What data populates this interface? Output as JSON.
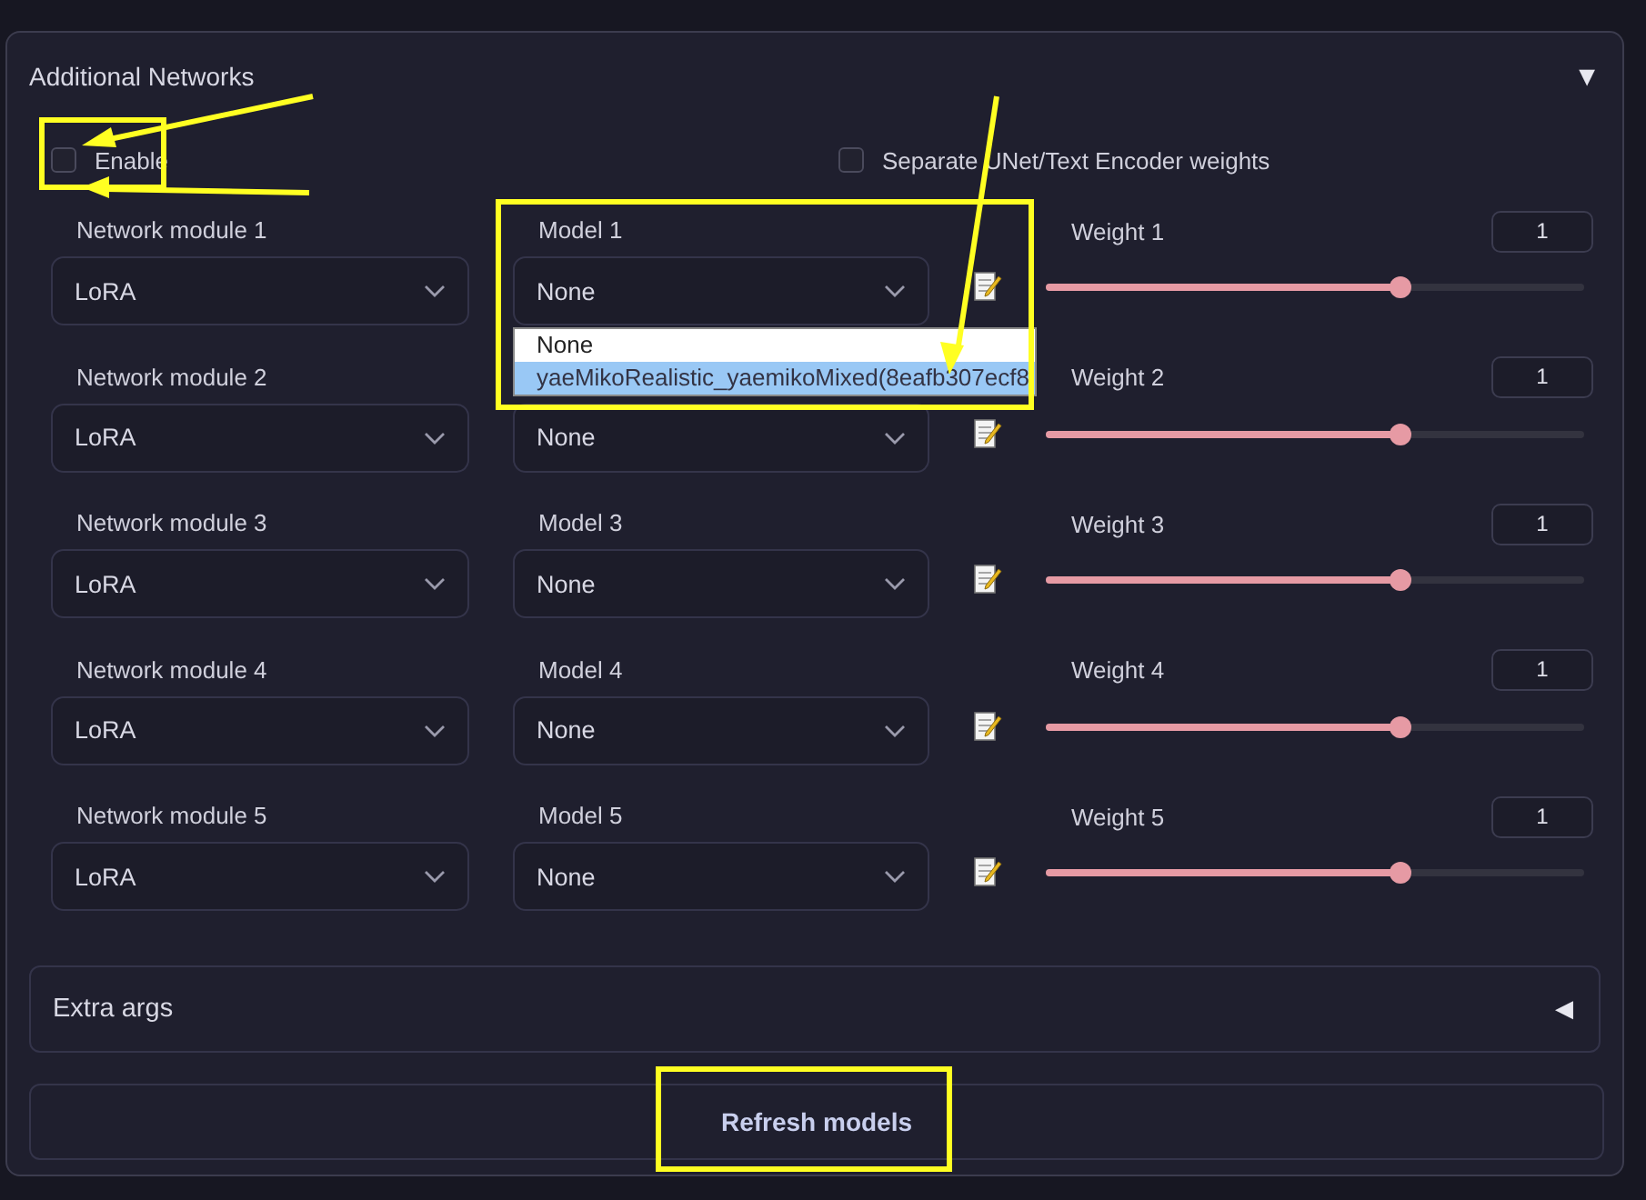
{
  "panel": {
    "title": "Additional Networks",
    "expanded": true,
    "toggle": "▼"
  },
  "options": [
    {
      "label": "Enable",
      "checked": false
    },
    {
      "label": "Separate UNet/Text Encoder weights",
      "checked": false
    }
  ],
  "networks": [
    {
      "module_label": "Network module 1",
      "module": "LoRA",
      "model_label": "Model 1",
      "model": "None",
      "weight_label": "Weight 1",
      "weight": "1",
      "level": 0.66
    },
    {
      "module_label": "Network module 2",
      "module": "LoRA",
      "model": "None",
      "weight_label": "Weight 2",
      "weight": "1",
      "level": 0.66
    },
    {
      "module_label": "Network module 3",
      "module": "LoRA",
      "model_label": "Model 3",
      "model": "None",
      "weight_label": "Weight 3",
      "weight": "1",
      "level": 0.66
    },
    {
      "module_label": "Network module 4",
      "module": "LoRA",
      "model_label": "Model 4",
      "model": "None",
      "weight_label": "Weight 4",
      "weight": "1",
      "level": 0.66
    },
    {
      "module_label": "Network module 5",
      "module": "LoRA",
      "model_label": "Model 5",
      "model": "None",
      "weight_label": "Weight 5",
      "weight": "1",
      "level": 0.66
    }
  ],
  "dropdown": {
    "options": [
      {
        "label": "None",
        "selected": false
      },
      {
        "label": "yaeMikoRealistic_yaemikoMixed(8eafb307ecf8",
        "selected": true
      }
    ]
  },
  "extra_args": {
    "title": "Extra args",
    "expanded": false,
    "toggle": "◀"
  },
  "refresh_button": "Refresh models"
}
